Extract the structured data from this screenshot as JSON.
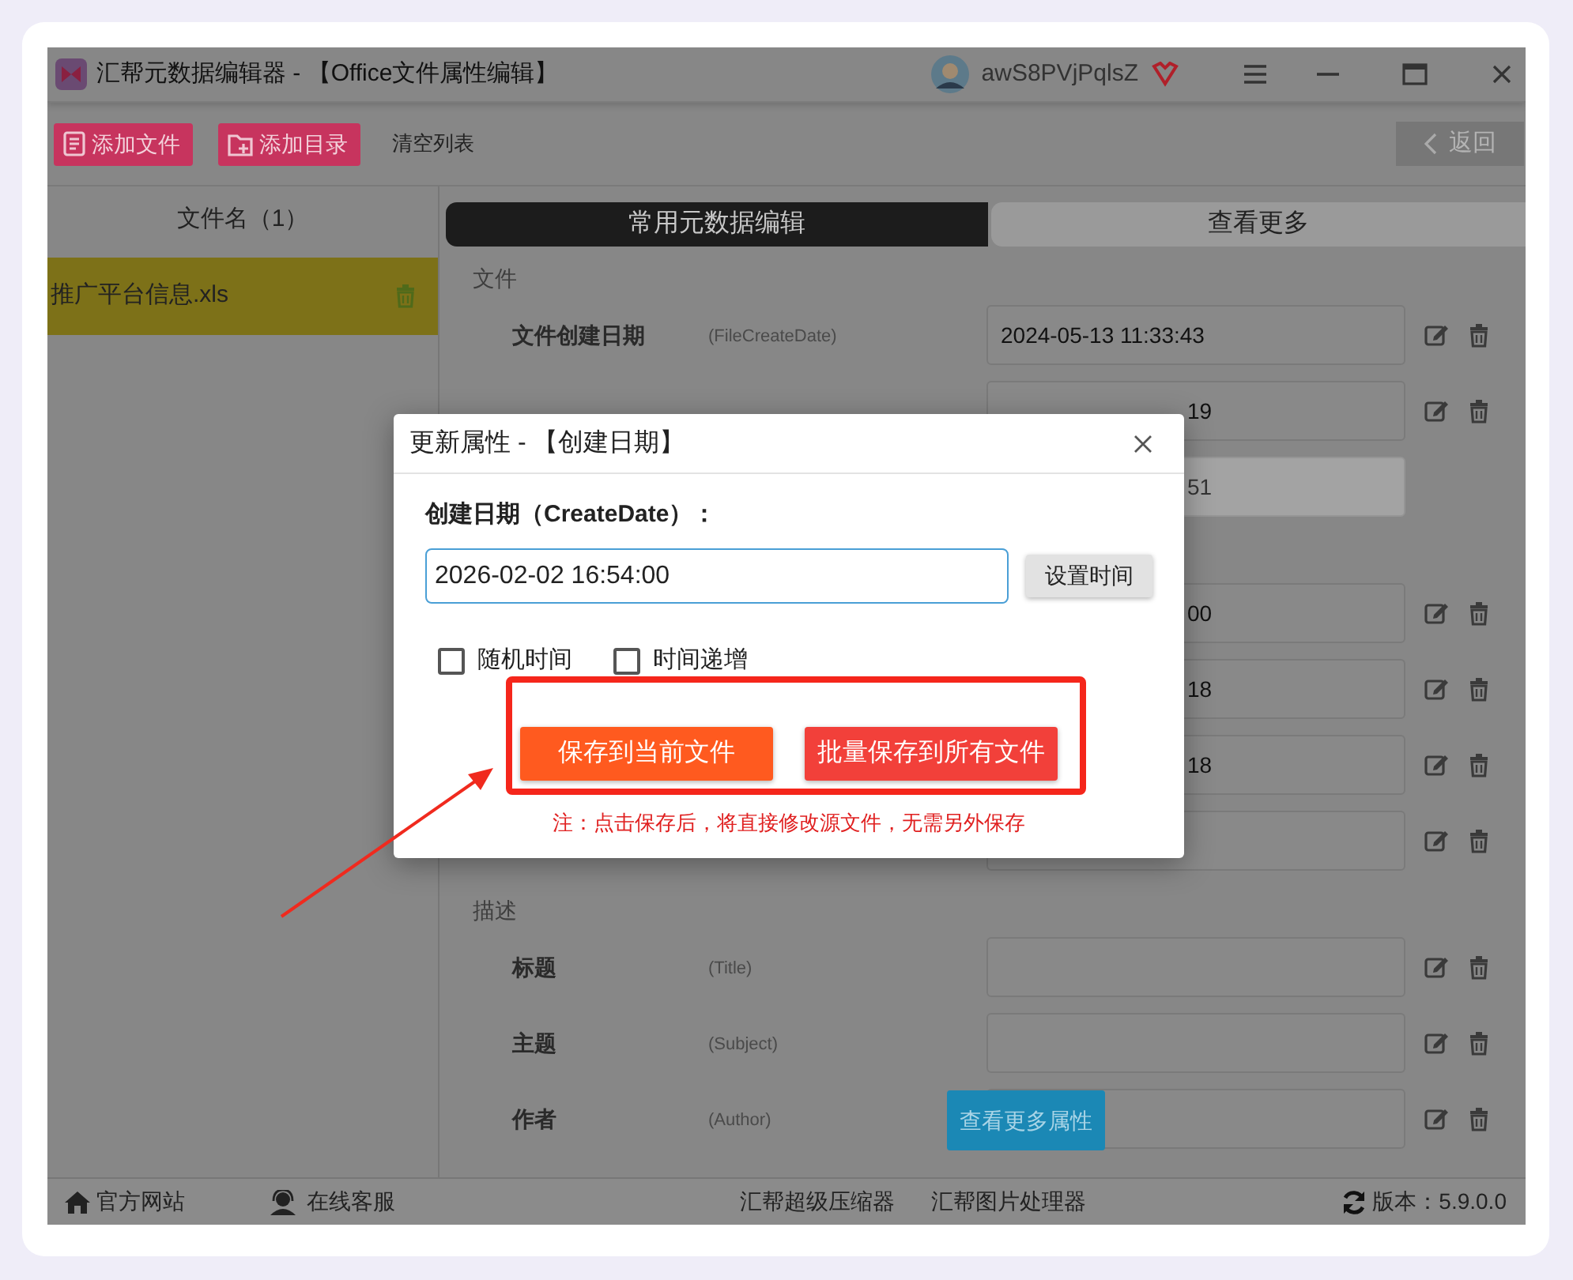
{
  "window": {
    "title": "汇帮元数据编辑器 - 【Office文件属性编辑】",
    "user": "awS8PVjPqlsZ"
  },
  "toolbar": {
    "buttons": [
      {
        "label": "添加文件",
        "kind": "add-file"
      },
      {
        "label": "添加目录",
        "kind": "add-folder"
      },
      {
        "label": "清空列表",
        "kind": "plain"
      }
    ],
    "back": "返回"
  },
  "file_list": {
    "header": "文件名（1）",
    "files": [
      {
        "name": "推广平台信息.xls",
        "selected": true
      }
    ]
  },
  "tabs": [
    {
      "label": "常用元数据编辑",
      "selected": true
    },
    {
      "label": "查看更多",
      "selected": false
    }
  ],
  "sections": [
    {
      "heading": "文件",
      "rows": [
        {
          "kind": "full",
          "label": "文件创建日期",
          "key": "(FileCreateDate)",
          "value": "2024-05-13 11:33:43",
          "disabled": false
        },
        {
          "kind": "partial",
          "value": "19",
          "disabled": false
        },
        {
          "kind": "partial",
          "value": "51",
          "disabled": true
        }
      ]
    },
    {
      "rows": [
        {
          "kind": "partial",
          "value": "00",
          "disabled": false
        },
        {
          "kind": "partial",
          "value": "18",
          "disabled": false
        },
        {
          "kind": "partial",
          "value": "18",
          "disabled": false
        },
        {
          "kind": "partial",
          "disabled": false
        }
      ]
    },
    {
      "heading": "描述",
      "rows": [
        {
          "kind": "full",
          "label": "标题",
          "key": "(Title)",
          "disabled": false
        },
        {
          "kind": "full",
          "label": "主题",
          "key": "(Subject)",
          "disabled": false
        },
        {
          "kind": "full",
          "label": "作者",
          "key": "(Author)",
          "disabled": false
        }
      ]
    }
  ],
  "more_button": "查看更多属性",
  "footer": {
    "links": [
      {
        "label": "官方网站",
        "kind": "home"
      },
      {
        "label": "在线客服",
        "kind": "support"
      },
      {
        "label": "汇帮超级压缩器",
        "kind": "plain"
      },
      {
        "label": "汇帮图片处理器",
        "kind": "plain"
      }
    ],
    "version": "版本：5.9.0.0"
  },
  "modal": {
    "title": "更新属性 - 【创建日期】",
    "field_label": "创建日期（CreateDate）：",
    "value": "2026-02-02 16:54:00",
    "set_time": "设置时间",
    "options": [
      {
        "label": "随机时间",
        "checked": false
      },
      {
        "label": "时间递增",
        "checked": false
      }
    ],
    "actions": [
      {
        "label": "保存到当前文件",
        "kind": "current"
      },
      {
        "label": "批量保存到所有文件",
        "kind": "all"
      }
    ],
    "note": "注：点击保存后，将直接修改源文件，无需另外保存"
  }
}
